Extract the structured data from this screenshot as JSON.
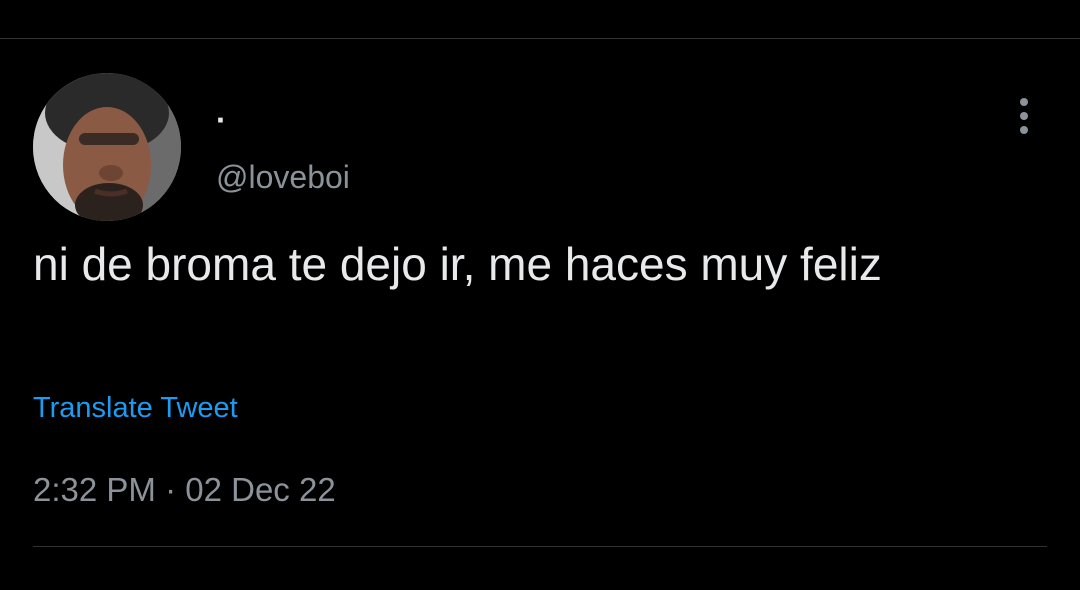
{
  "tweet": {
    "author": {
      "display_name": "·",
      "handle": "@loveboi",
      "avatar_icon": "profile-photo"
    },
    "text": "ni de broma te dejo ir, me haces muy feliz",
    "translate_label": "Translate Tweet",
    "time": "2:32 PM",
    "separator": "·",
    "date": "02 Dec 22",
    "more_icon": "more-options-icon"
  },
  "colors": {
    "background": "#000000",
    "primary_text": "#e7e9ea",
    "secondary_text": "#8b9299",
    "link": "#1d9bf0",
    "divider": "#2f3336"
  }
}
